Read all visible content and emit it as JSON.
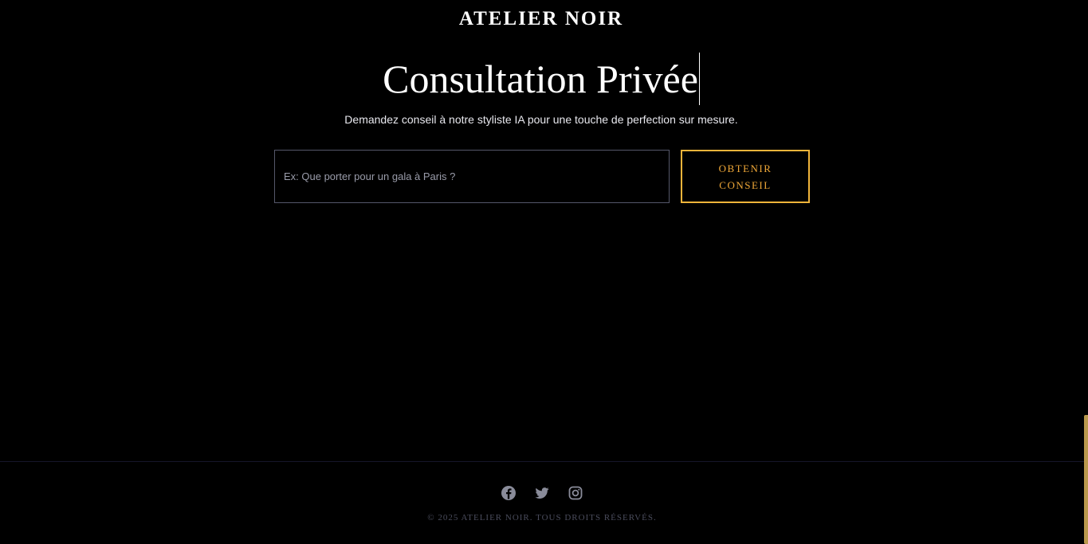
{
  "header": {
    "brand": "ATELIER NOIR"
  },
  "hero": {
    "title": "Consultation Privée",
    "subtitle": "Demandez conseil à notre styliste IA pour une touche de perfection sur mesure."
  },
  "consultation": {
    "input_value": "",
    "input_placeholder": "Ex: Que porter pour un gala à Paris ?",
    "button_label": "OBTENIR CONSEIL"
  },
  "footer": {
    "social_icons": [
      "facebook-icon",
      "twitter-icon",
      "instagram-icon"
    ],
    "copyright": "© 2025 ATELIER NOIR. TOUS DROITS RÉSERVÉS."
  },
  "colors": {
    "background": "#000000",
    "accent_gold": "#f0b43a",
    "text_primary": "#ffffff",
    "text_muted": "#4a4c5c",
    "icon_gray": "#8a8c9a"
  }
}
